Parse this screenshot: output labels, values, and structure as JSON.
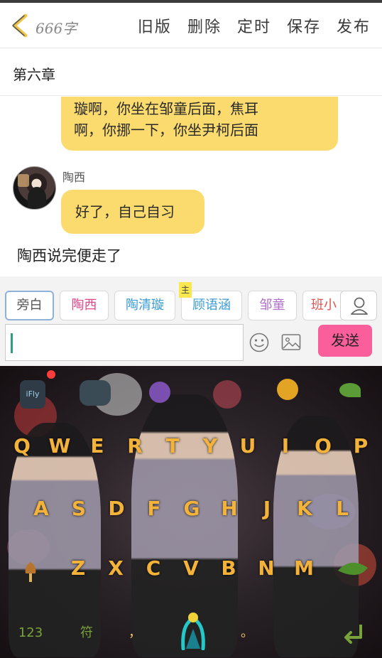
{
  "header": {
    "word_count": "666字",
    "actions": [
      "旧版",
      "删除",
      "定时",
      "保存",
      "发布"
    ]
  },
  "chapter": {
    "title": "第六章"
  },
  "messages": {
    "top_bubble": [
      "璇啊，你坐在邹童后面，焦耳",
      "啊，你挪一下，你坐尹柯后面"
    ],
    "speaker": "陶西",
    "reply_bubble": "好了，自己自习",
    "narration": "陶西说完便走了"
  },
  "characters": [
    {
      "name": "旁白",
      "color": "#555555"
    },
    {
      "name": "陶西",
      "color": "#e0468a"
    },
    {
      "name": "陶清璇",
      "color": "#3a9bd6"
    },
    {
      "name": "顾语涵",
      "color": "#3a9bd6",
      "badge": "主"
    },
    {
      "name": "邹童",
      "color": "#b270c9"
    },
    {
      "name": "班小",
      "color": "#e35050"
    }
  ],
  "composer": {
    "send_label": "发送",
    "placeholder": ""
  },
  "keyboard": {
    "row1": [
      "Q",
      "W",
      "E",
      "R",
      "T",
      "Y",
      "U",
      "I",
      "O",
      "P"
    ],
    "row2": [
      "A",
      "S",
      "D",
      "F",
      "G",
      "H",
      "J",
      "K",
      "L"
    ],
    "row3": [
      "Z",
      "X",
      "C",
      "V",
      "B",
      "N",
      "M"
    ],
    "bottom": {
      "numbers": "123",
      "symbols": "符",
      "comma": "，",
      "period": "。"
    },
    "key_color": "#f3b23a",
    "brand": "iFly"
  },
  "icons": [
    "back-chevron-icon",
    "profile-icon",
    "emoji-icon",
    "image-icon",
    "microphone-icon",
    "enter-icon"
  ],
  "colors": {
    "bubble": "#fbdb6e",
    "send": "#fb5f9b",
    "selected_chip_border": "#8fb0d9"
  }
}
